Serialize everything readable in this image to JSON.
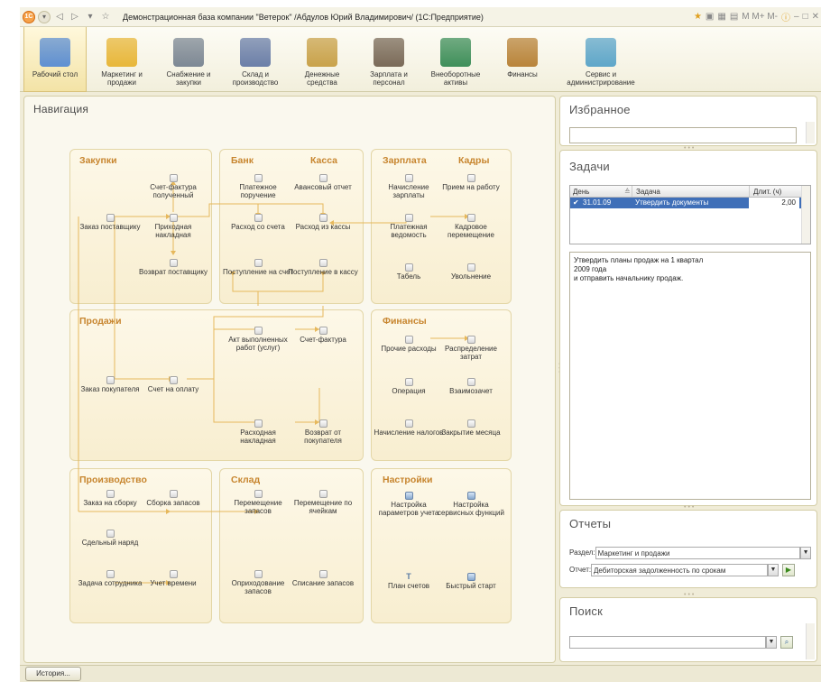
{
  "window": {
    "title": "Демонстрационная база компании \"Ветерок\" /Абдулов Юрий Владимирович/ (1С:Предприятие)",
    "mem_buttons": "M  M+ M-"
  },
  "sections": [
    {
      "label": "Рабочий стол",
      "icon": "desktop-icon",
      "color": "#5f90d2"
    },
    {
      "label": "Маркетинг и продажи",
      "icon": "pie-chart-icon",
      "color": "#e8b73a"
    },
    {
      "label": "Снабжение и закупки",
      "icon": "truck-icon",
      "color": "#7d8894"
    },
    {
      "label": "Склад и производство",
      "icon": "warehouse-icon",
      "color": "#6b7fa8"
    },
    {
      "label": "Денежные средства",
      "icon": "coins-icon",
      "color": "#c9a24a"
    },
    {
      "label": "Зарплата и персонал",
      "icon": "person-icon",
      "color": "#7a6a58"
    },
    {
      "label": "Внеоборотные активы",
      "icon": "assets-icon",
      "color": "#3f8f5a"
    },
    {
      "label": "Финансы",
      "icon": "cabinet-icon",
      "color": "#b9843a"
    },
    {
      "label": "Сервис и администрирование",
      "icon": "database-icon",
      "color": "#5ea6c9"
    }
  ],
  "nav": {
    "title": "Навигация",
    "groups": {
      "zakupki": {
        "title": "Закупки",
        "items": [
          "Счет-фактура полученный",
          "Заказ поставщику",
          "Приходная накладная",
          "Возврат поставщику"
        ]
      },
      "bank": {
        "title": "Банк",
        "items": [
          "Платежное поручение",
          "Расход со счета",
          "Поступление на счет"
        ]
      },
      "kassa": {
        "title": "Касса",
        "items": [
          "Авансовый отчет",
          "Расход из кассы",
          "Поступление в кассу"
        ]
      },
      "zarplata": {
        "title": "Зарплата",
        "items": [
          "Начисление зарплаты",
          "Платежная ведомость",
          "Табель"
        ]
      },
      "kadry": {
        "title": "Кадры",
        "items": [
          "Прием на работу",
          "Кадровое перемещение",
          "Увольнение"
        ]
      },
      "prodazhi": {
        "title": "Продажи",
        "items": [
          "Акт выполненных работ (услуг)",
          "Счет-фактура",
          "Заказ покупателя",
          "Счет на оплату",
          "Расходная накладная",
          "Возврат от покупателя"
        ]
      },
      "finansy": {
        "title": "Финансы",
        "items": [
          "Прочие расходы",
          "Распределение затрат",
          "Операция",
          "Взаимозачет",
          "Начисление налогов",
          "Закрытие месяца"
        ]
      },
      "proizvodstvo": {
        "title": "Производство",
        "items": [
          "Заказ на сборку",
          "Сборка запасов",
          "Сдельный наряд",
          "Задача сотрудника",
          "Учет времени"
        ]
      },
      "sklad": {
        "title": "Склад",
        "items": [
          "Перемещение запасов",
          "Перемещение по ячейкам",
          "Оприходование запасов",
          "Списание запасов"
        ]
      },
      "nastroiki": {
        "title": "Настройки",
        "items": [
          "Настройка параметров учета",
          "Настройка сервисных функций",
          "План счетов",
          "Быстрый старт"
        ]
      }
    }
  },
  "favorites": {
    "title": "Избранное"
  },
  "tasks": {
    "title": "Задачи",
    "columns": [
      "День",
      "Задача",
      "Длит. (ч)"
    ],
    "rows": [
      {
        "day": "31.01.09",
        "task": "Утвердить документы",
        "duration": "2,00"
      }
    ],
    "note_lines": [
      "Утвердить планы продаж на 1 квартал",
      "2009 года",
      "и отправить начальнику продаж."
    ]
  },
  "reports": {
    "title": "Отчеты",
    "section_label": "Раздел:",
    "section_value": "Маркетинг и продажи",
    "report_label": "Отчет:",
    "report_value": "Дебиторская задолженность по срокам"
  },
  "search": {
    "title": "Поиск",
    "value": ""
  },
  "status": {
    "history_button": "История..."
  },
  "colors": {
    "accent": "#c7852e",
    "wire": "#e6b85c",
    "selected_row": "#3f6fb8"
  }
}
